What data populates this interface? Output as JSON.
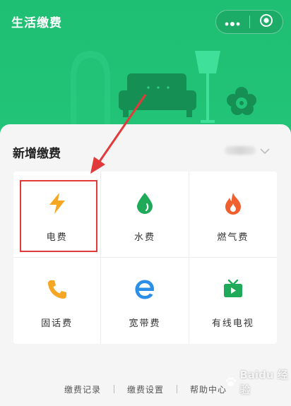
{
  "header": {
    "title": "生活缴费",
    "more_icon": "more-dots-icon",
    "close_icon": "target-circle-icon"
  },
  "main": {
    "section_title": "新增缴费",
    "region_chevron_icon": "chevron-down-icon",
    "services": [
      {
        "label": "电费",
        "icon": "lightning-icon",
        "color": "#f5a623"
      },
      {
        "label": "水费",
        "icon": "water-drop-icon",
        "color": "#1faa59"
      },
      {
        "label": "燃气费",
        "icon": "flame-icon",
        "color": "#f0602e"
      },
      {
        "label": "固话费",
        "icon": "phone-icon",
        "color": "#f5a623"
      },
      {
        "label": "宽带费",
        "icon": "browser-e-icon",
        "color": "#2b8fe8"
      },
      {
        "label": "有线电视",
        "icon": "tv-icon",
        "color": "#1faa59"
      }
    ]
  },
  "footer": {
    "links": [
      "缴费记录",
      "缴费设置",
      "帮助中心"
    ]
  },
  "colors": {
    "header_green": "#1fbf73",
    "annotation_red": "#e23a3a"
  },
  "watermark": {
    "text": "Baidu 经验"
  }
}
